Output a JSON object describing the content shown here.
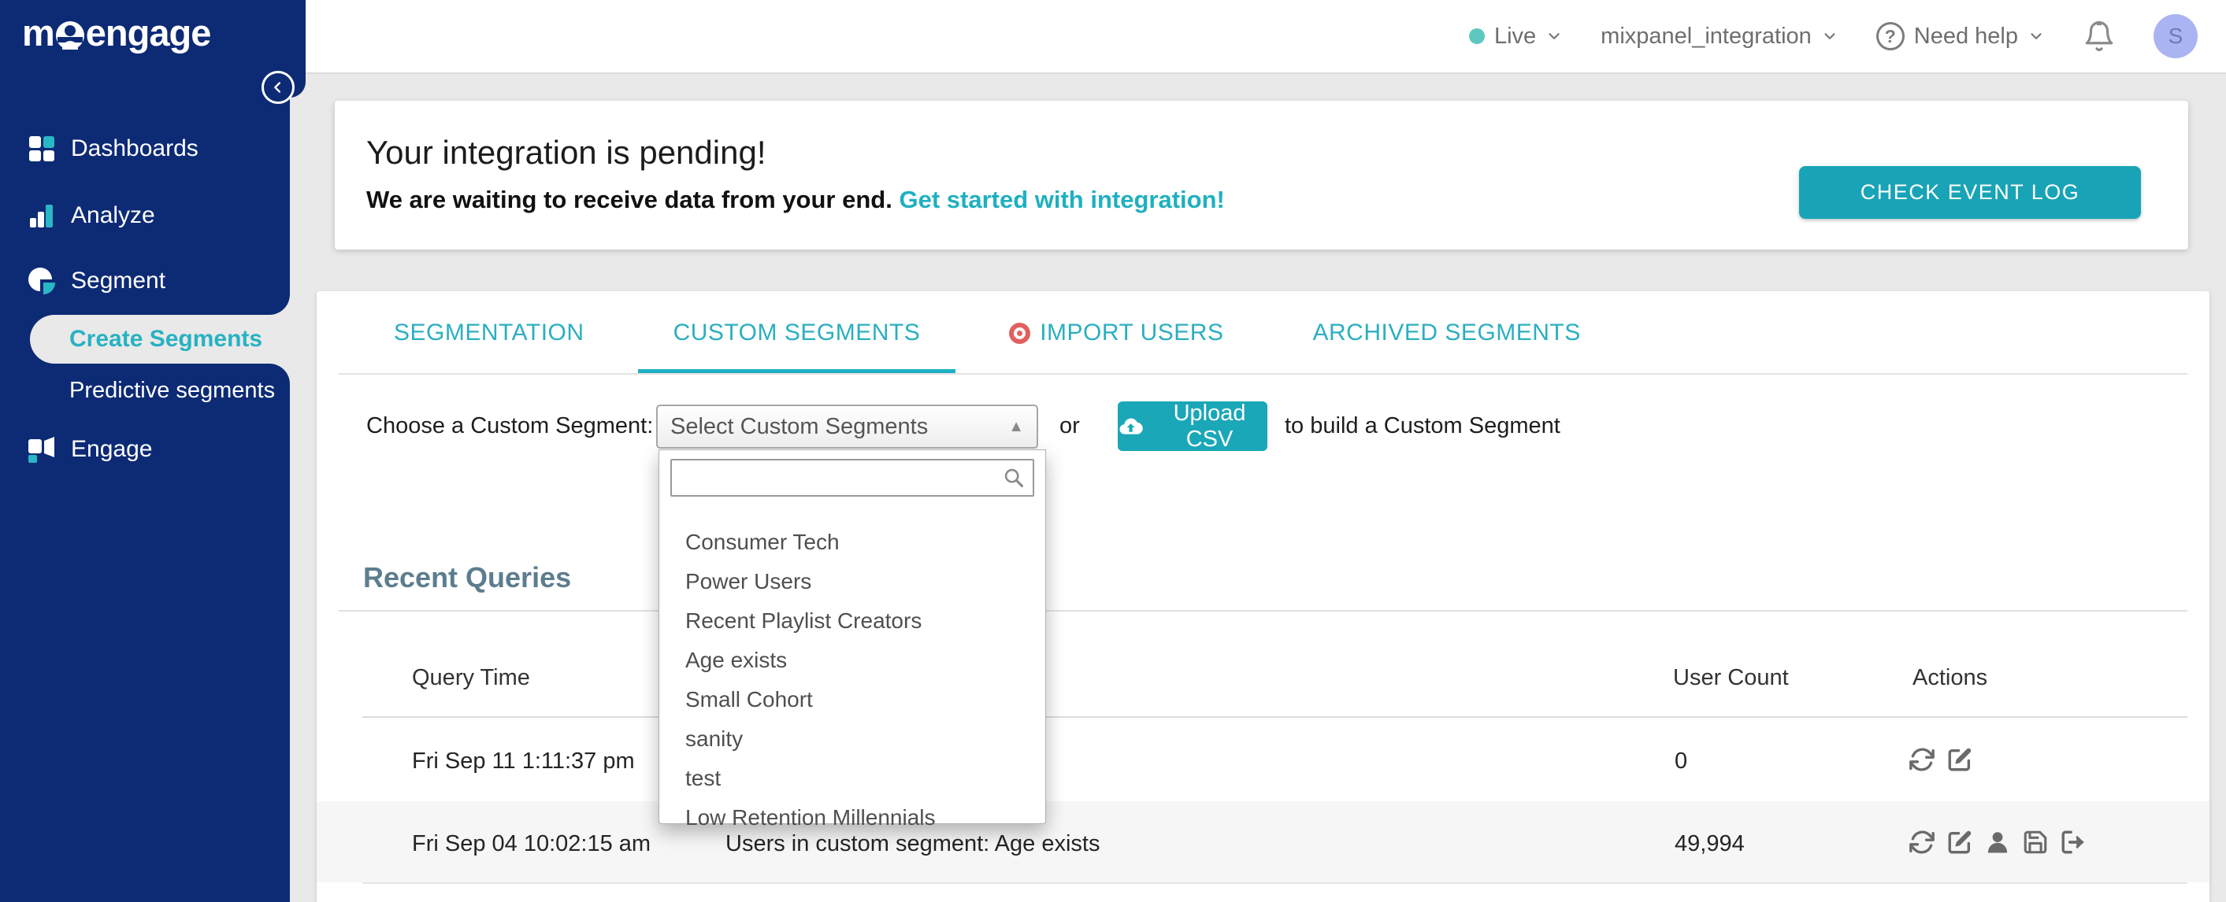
{
  "brand": {
    "logo_prefix": "m",
    "logo_suffix": "engage"
  },
  "topbar": {
    "environment": "Live",
    "project": "mixpanel_integration",
    "help": "Need help",
    "help_mark": "?",
    "avatar_initial": "S"
  },
  "sidebar": {
    "dashboards": "Dashboards",
    "analyze": "Analyze",
    "segment": "Segment",
    "create_segments": "Create Segments",
    "predictive_segments": "Predictive segments",
    "engage": "Engage"
  },
  "banner": {
    "title": "Your integration is pending!",
    "message": "We are waiting to receive data from your end.",
    "link": "Get started with integration!",
    "button": "CHECK EVENT LOG"
  },
  "tabs": {
    "segmentation": "SEGMENTATION",
    "custom_segments": "CUSTOM SEGMENTS",
    "import_users": "IMPORT USERS",
    "archived_segments": "ARCHIVED SEGMENTS"
  },
  "chooser": {
    "label": "Choose a Custom Segment:",
    "select_value": "Select Custom Segments",
    "select_arrow": "▲",
    "search_value": "",
    "or": "or",
    "upload": "Upload CSV",
    "suffix": "to build a Custom Segment"
  },
  "dropdown_options": [
    "Consumer Tech",
    "Power Users",
    "Recent Playlist Creators",
    "Age exists",
    "Small Cohort",
    "sanity",
    "test",
    "Low Retention Millennials"
  ],
  "recent_queries": {
    "title": "Recent Queries",
    "columns": {
      "query_time": "Query Time",
      "user_count": "User Count",
      "actions": "Actions"
    },
    "rows": [
      {
        "query_time": "Fri Sep 11 1:11:37 pm",
        "user_count": "0",
        "actions": [
          "refresh-icon",
          "edit-icon"
        ]
      },
      {
        "query_time": "Fri Sep 04 10:02:15 am",
        "query_info": "Users in custom segment: Age exists",
        "user_count": "49,994",
        "actions": [
          "refresh-icon",
          "edit-icon",
          "user-icon",
          "save-icon",
          "export-icon"
        ]
      }
    ]
  },
  "colors": {
    "navy": "#0d2a75",
    "teal": "#1aa7b8",
    "teal_text": "#2bafc0",
    "live_dot": "#5ec8c0",
    "import_dot": "#e0605f",
    "avatar_bg": "#aab4f2",
    "heading": "#5c7d8e",
    "background": "#e9e9e9"
  },
  "icons": [
    "collapse-icon",
    "chevron-down-icon",
    "help-icon",
    "bell-icon",
    "search-icon",
    "cloud-upload-icon",
    "import-dot-icon",
    "dropdown-arrow-icon",
    "refresh-icon",
    "edit-icon",
    "user-icon",
    "save-icon",
    "export-icon"
  ]
}
